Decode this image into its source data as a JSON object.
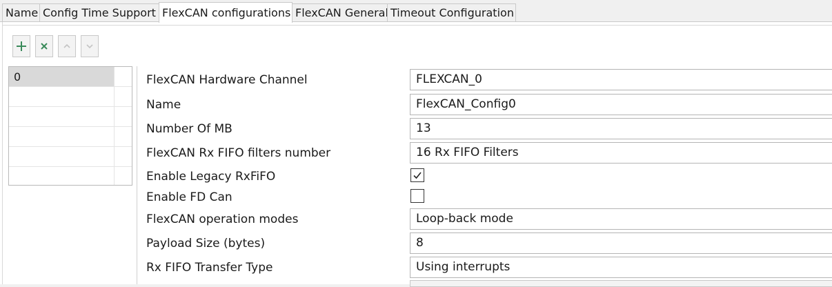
{
  "tabs": [
    {
      "label": "Name"
    },
    {
      "label": "Config Time Support"
    },
    {
      "label": "FlexCAN configurations",
      "active": true
    },
    {
      "label": "FlexCAN General"
    },
    {
      "label": "Timeout Configuration"
    }
  ],
  "toolbar": {
    "add_icon": "plus-icon",
    "remove_icon": "x-icon",
    "up_icon": "chevron-up-icon",
    "down_icon": "chevron-down-icon",
    "colors": {
      "add": "#3a8a5a",
      "remove": "#3a8a5a",
      "disabled": "#c4c4c4"
    }
  },
  "list": {
    "rows": [
      "0",
      "",
      "",
      "",
      "",
      ""
    ],
    "selected_index": 0
  },
  "properties": {
    "hardware_channel": {
      "label": "FlexCAN Hardware Channel",
      "value": "FLEXCAN_0"
    },
    "name": {
      "label": "Name",
      "value": "FlexCAN_Config0"
    },
    "number_of_mb": {
      "label": "Number Of MB",
      "value": "13"
    },
    "rx_fifo_filters": {
      "label": "FlexCAN Rx FIFO filters number",
      "value": "16 Rx FIFO Filters"
    },
    "enable_legacy_rxfifo": {
      "label": "Enable Legacy RxFiFO",
      "checked": true
    },
    "enable_fd_can": {
      "label": "Enable FD Can",
      "checked": false
    },
    "operation_modes": {
      "label": "FlexCAN operation modes",
      "value": "Loop-back mode"
    },
    "payload_size": {
      "label": "Payload Size (bytes)",
      "value": "8"
    },
    "rx_fifo_transfer_type": {
      "label": "Rx FIFO Transfer Type",
      "value": "Using interrupts"
    }
  }
}
